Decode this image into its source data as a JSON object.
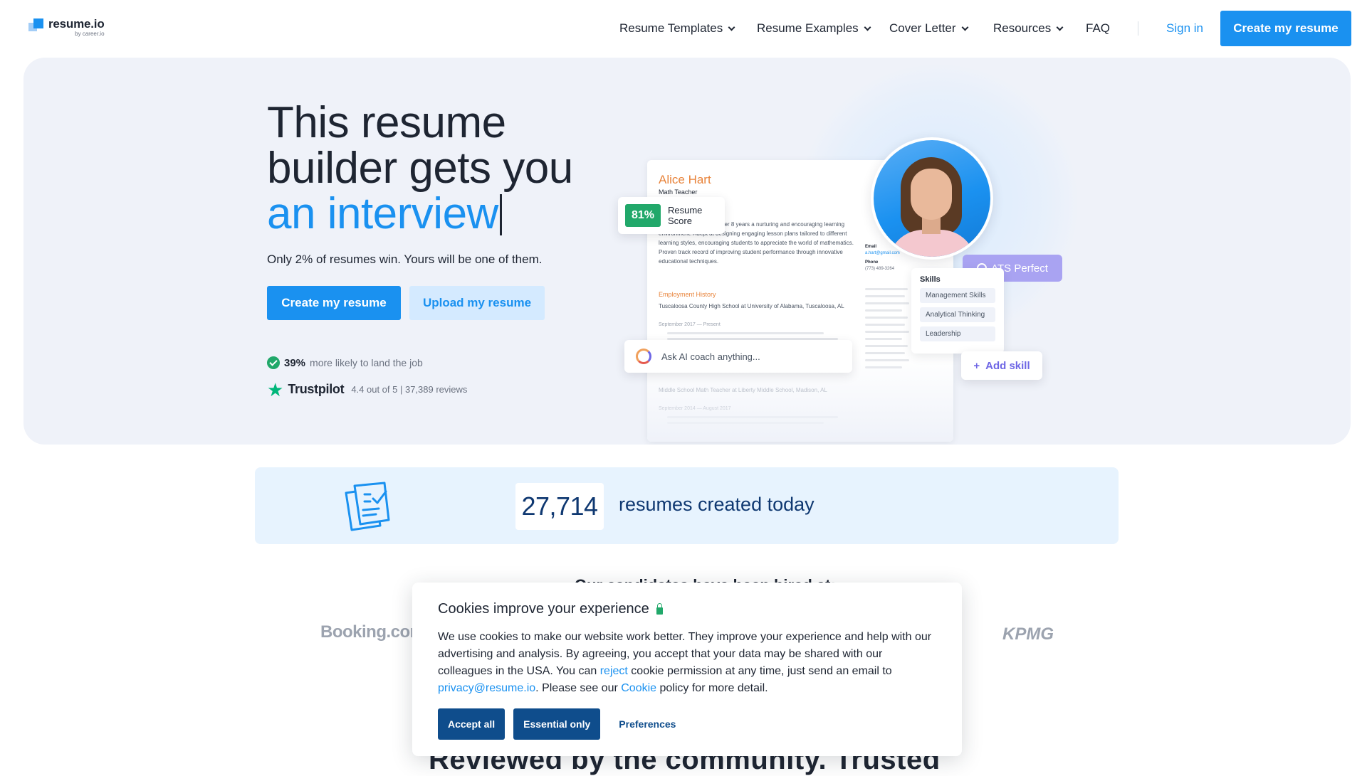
{
  "header": {
    "logo_name": "resume.io",
    "logo_sub": "by career.io",
    "nav": [
      "Resume Templates",
      "Resume Examples",
      "Cover Letter",
      "Resources",
      "FAQ"
    ],
    "sign_in": "Sign in",
    "cta": "Create my resume"
  },
  "hero": {
    "headline_line1": "This resume",
    "headline_line2": "builder gets you",
    "headline_line3": "an interview",
    "subline": "Only 2% of resumes win. Yours will be one of them.",
    "btn_create": "Create my resume",
    "btn_upload": "Upload my resume",
    "stat_value": "39%",
    "stat_text": "more likely to land the job",
    "trustpilot_name": "Trustpilot",
    "trustpilot_rating": "4.4 out of 5 | 37,389 reviews"
  },
  "preview": {
    "name": "Alice Hart",
    "role": "Math Teacher",
    "summary": "astic math teacher with over 8 years a nurturing and encouraging learning environment. Adept at designing engaging lesson plans tailored to different learning styles, encouraging students to appreciate the world of mathematics. Proven track record of improving student performance through innovative educational techniques.",
    "section_employment": "Employment History",
    "job1": "Tuscaloosa County High School at University of Alabama, Tuscaloosa, AL",
    "job1_date": "September 2017 — Present",
    "job2": "Middle School Math Teacher at Liberty Middle School, Madison, AL",
    "job2_date": "September 2014 — August 2017",
    "phone_label": "Phone",
    "phone": "(773) 489-3264",
    "email_label": "Email",
    "email": "a.hart@gmail.com",
    "score_value": "81%",
    "score_label_1": "Resume",
    "score_label_2": "Score",
    "ats": "ATS Perfect",
    "skills_title": "Skills",
    "skills": [
      "Management Skills",
      "Analytical Thinking",
      "Leadership"
    ],
    "add_skill": "Add skill",
    "ai_placeholder": "Ask AI coach anything..."
  },
  "counter": {
    "number": "27,714",
    "text": "resumes created today"
  },
  "logos": {
    "title": "Our candidates have been hired at:",
    "booking": "Booking.com",
    "kpmg": "KPMG"
  },
  "reviewed_heading": "Reviewed by the community. Trusted",
  "cookie": {
    "title": "Cookies improve your experience",
    "text_1": "We use cookies to make our website work better. They improve your experience and help with our advertising and analysis. By agreeing, you accept that your data may be shared with our colleagues in the USA. You can ",
    "reject_link": "reject",
    "text_2": " cookie permission at any time, just send an email to ",
    "email_link": "privacy@resume.io",
    "text_3": ". Please see our ",
    "cookie_link": "Cookie",
    "text_4": " policy for more detail.",
    "accept_all": "Accept all",
    "essential_only": "Essential only",
    "preferences": "Preferences"
  },
  "colors": {
    "primary": "#1a91f0",
    "dark_navy": "#0f4d8c",
    "success": "#21a86a",
    "accent_orange": "#e8833a",
    "ats_purple": "#a9a3f2",
    "hero_bg": "#eff2f9"
  }
}
